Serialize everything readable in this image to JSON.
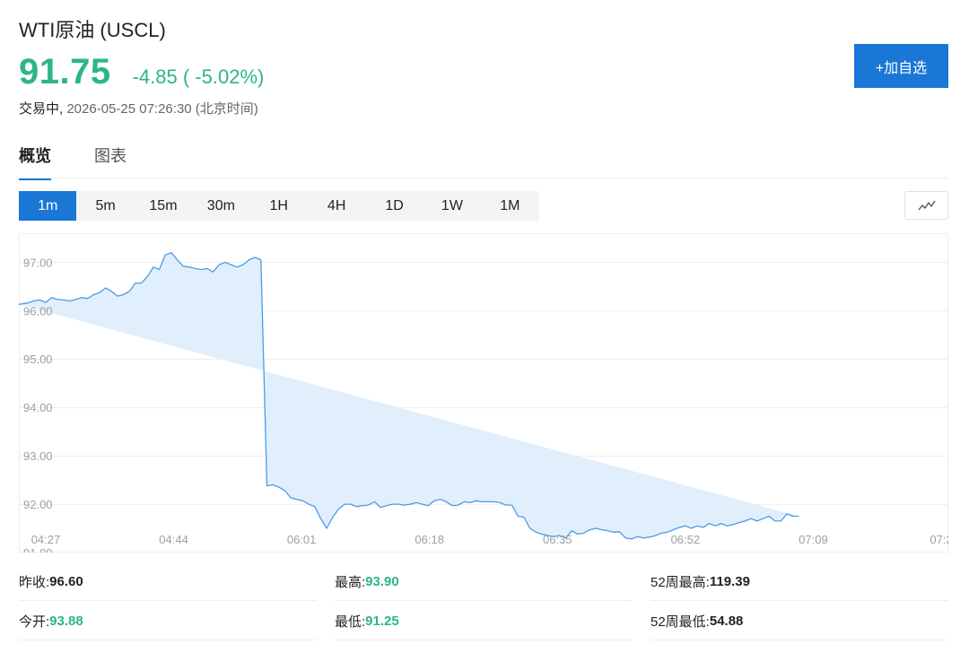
{
  "header": {
    "title": "WTI原油 (USCL)",
    "price": "91.75",
    "change": "-4.85 ( -5.02%)",
    "status": "交易中,",
    "timestamp": "2026-05-25 07:26:30 (北京时间)",
    "add_button": "+加自选"
  },
  "colors": {
    "accent": "#1a77d6",
    "down_green": "#2cb58a",
    "chart_line": "#4a9be8",
    "chart_fill": "#e1effc"
  },
  "tabs": [
    {
      "label": "概览",
      "active": true
    },
    {
      "label": "图表",
      "active": false
    }
  ],
  "periods": [
    {
      "label": "1m",
      "active": true
    },
    {
      "label": "5m",
      "active": false
    },
    {
      "label": "15m",
      "active": false
    },
    {
      "label": "30m",
      "active": false
    },
    {
      "label": "1H",
      "active": false
    },
    {
      "label": "4H",
      "active": false
    },
    {
      "label": "1D",
      "active": false
    },
    {
      "label": "1W",
      "active": false
    },
    {
      "label": "1M",
      "active": false
    }
  ],
  "chart_toggle_icon": "line-chart-icon",
  "chart_data": {
    "type": "area",
    "ylim": [
      91.0,
      97.6
    ],
    "y_ticks": [
      "97.00",
      "96.00",
      "95.00",
      "94.00",
      "93.00",
      "92.00",
      "91.00"
    ],
    "y_tick_values": [
      97,
      96,
      95,
      94,
      93,
      92,
      91
    ],
    "x_ticks": [
      "04:27",
      "04:44",
      "06:01",
      "06:18",
      "06:35",
      "06:52",
      "07:09",
      "07:2"
    ],
    "x_tick_positions": [
      2,
      23.4,
      44.8,
      66.2,
      87.6,
      109,
      130.4,
      151.8
    ],
    "x_range": [
      -2.5,
      153
    ],
    "x": [
      -2.5,
      -1,
      0,
      1,
      2,
      3,
      4,
      5,
      6,
      7,
      8,
      9,
      10,
      11,
      12,
      13,
      14,
      15,
      16,
      17,
      18,
      19,
      20,
      21,
      22,
      23,
      24,
      25,
      26,
      27,
      28,
      29,
      30,
      31,
      32,
      33,
      34,
      35,
      36,
      37,
      38,
      39,
      40,
      41,
      42,
      43,
      44,
      45,
      46,
      47,
      48,
      49,
      50,
      51,
      52,
      53,
      54,
      55,
      56,
      57,
      58,
      59,
      60,
      61,
      62,
      63,
      64,
      65,
      66,
      67,
      68,
      69,
      70,
      71,
      72,
      73,
      74,
      75,
      76,
      77,
      78,
      79,
      80,
      81,
      82,
      83,
      84,
      85,
      86,
      87,
      88,
      89,
      90,
      91,
      92,
      93,
      94,
      95,
      96,
      97,
      98,
      99,
      100,
      101,
      102,
      103,
      104,
      105,
      106,
      107,
      108,
      109,
      110,
      111,
      112,
      113,
      114,
      115,
      116,
      117,
      118,
      119,
      120,
      121,
      122,
      123,
      124,
      125,
      126,
      127,
      128,
      129,
      130,
      131,
      132,
      133,
      134,
      135,
      136,
      137,
      138,
      139,
      140,
      141,
      142,
      143,
      144,
      145,
      146,
      147,
      148,
      149,
      150,
      151,
      152,
      153
    ],
    "values": [
      96.13,
      96.16,
      96.2,
      96.22,
      96.17,
      96.27,
      96.23,
      96.22,
      96.2,
      96.23,
      96.27,
      96.25,
      96.33,
      96.37,
      96.47,
      96.4,
      96.3,
      96.33,
      96.4,
      96.57,
      96.57,
      96.7,
      96.9,
      96.85,
      97.15,
      97.2,
      97.05,
      96.92,
      96.9,
      96.87,
      96.85,
      96.87,
      96.8,
      96.95,
      97.0,
      96.95,
      96.9,
      96.95,
      97.05,
      97.1,
      97.05,
      92.38,
      92.4,
      92.35,
      92.28,
      92.13,
      92.1,
      92.07,
      92.0,
      91.95,
      91.7,
      91.5,
      91.73,
      91.9,
      92.0,
      92.0,
      91.95,
      91.97,
      91.98,
      92.05,
      91.93,
      91.97,
      92.0,
      92.0,
      91.98,
      92.0,
      92.03,
      92.0,
      91.97,
      92.07,
      92.1,
      92.05,
      91.97,
      91.98,
      92.05,
      92.03,
      92.07,
      92.05,
      92.05,
      92.05,
      92.03,
      91.98,
      91.98,
      91.75,
      91.73,
      91.5,
      91.42,
      91.38,
      91.35,
      91.33,
      91.35,
      91.3,
      91.45,
      91.38,
      91.4,
      91.47,
      91.5,
      91.47,
      91.45,
      91.42,
      91.43,
      91.3,
      91.28,
      91.33,
      91.3,
      91.32,
      91.35,
      91.4,
      91.42,
      91.47,
      91.52,
      91.55,
      91.5,
      91.55,
      91.52,
      91.6,
      91.55,
      91.6,
      91.55,
      91.58,
      91.62,
      91.65,
      91.7,
      91.65,
      91.7,
      91.75,
      91.65,
      91.65,
      91.8,
      91.75,
      91.75
    ]
  },
  "stats": [
    {
      "label": "昨收:",
      "value": "96.60",
      "color": "#222222"
    },
    {
      "label": "最高:",
      "value": "93.90",
      "color": "#2cb58a"
    },
    {
      "label": "52周最高:",
      "value": "119.39",
      "color": "#222222"
    },
    {
      "label": "今开:",
      "value": "93.88",
      "color": "#2cb58a"
    },
    {
      "label": "最低:",
      "value": "91.25",
      "color": "#2cb58a"
    },
    {
      "label": "52周最低:",
      "value": "54.88",
      "color": "#222222"
    }
  ]
}
